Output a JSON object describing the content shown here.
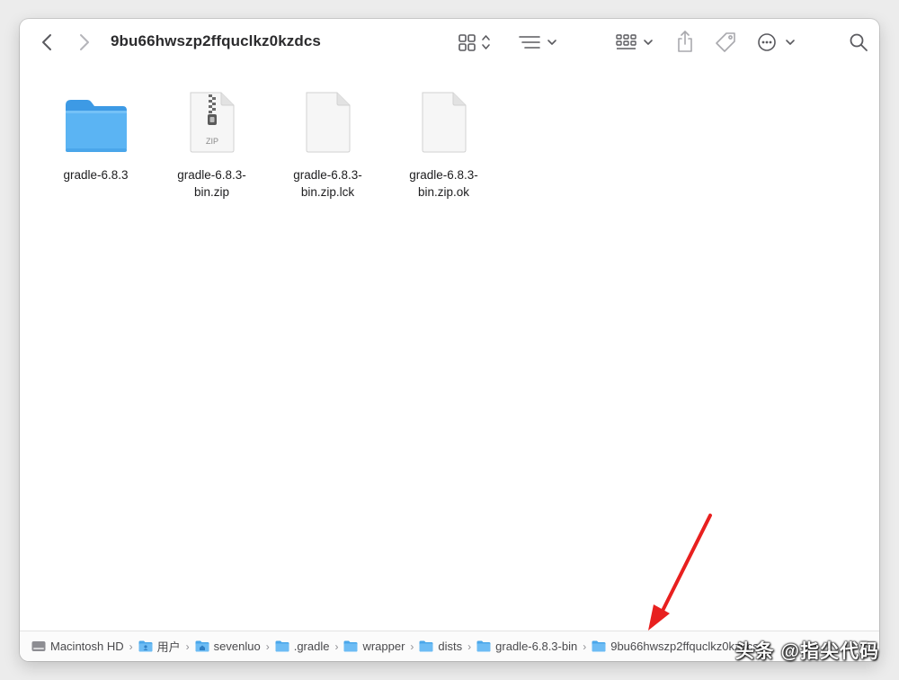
{
  "window": {
    "title": "9bu66hwszp2ffquclkz0kzdcs"
  },
  "toolbar": {
    "back_icon": "chevron-left-icon",
    "forward_icon": "chevron-right-icon",
    "view_icon": "grid-view-icon",
    "list_icon": "list-options-icon",
    "group_icon": "group-icon",
    "share_icon": "share-icon",
    "tag_icon": "tag-icon",
    "more_icon": "ellipsis-circle-icon",
    "search_icon": "search-icon"
  },
  "files": [
    {
      "name": "gradle-6.8.3",
      "kind": "folder"
    },
    {
      "name": "gradle-6.8.3-bin.zip",
      "kind": "zip",
      "badge": "ZIP"
    },
    {
      "name": "gradle-6.8.3-bin.zip.lck",
      "kind": "document"
    },
    {
      "name": "gradle-6.8.3-bin.zip.ok",
      "kind": "document"
    }
  ],
  "pathbar": [
    {
      "label": "Macintosh HD",
      "icon": "disk-icon"
    },
    {
      "label": "用户",
      "icon": "folder-icon"
    },
    {
      "label": "sevenluo",
      "icon": "home-folder-icon"
    },
    {
      "label": ".gradle",
      "icon": "folder-icon"
    },
    {
      "label": "wrapper",
      "icon": "folder-icon"
    },
    {
      "label": "dists",
      "icon": "folder-icon"
    },
    {
      "label": "gradle-6.8.3-bin",
      "icon": "folder-icon"
    },
    {
      "label": "9bu66hwszp2ffquclkz0kzdcs",
      "icon": "folder-icon"
    }
  ],
  "watermark": "头条 @指尖代码",
  "colors": {
    "folder": "#5bb4f3",
    "folder_tab": "#3d9ae5",
    "arrow": "#e8201f"
  }
}
